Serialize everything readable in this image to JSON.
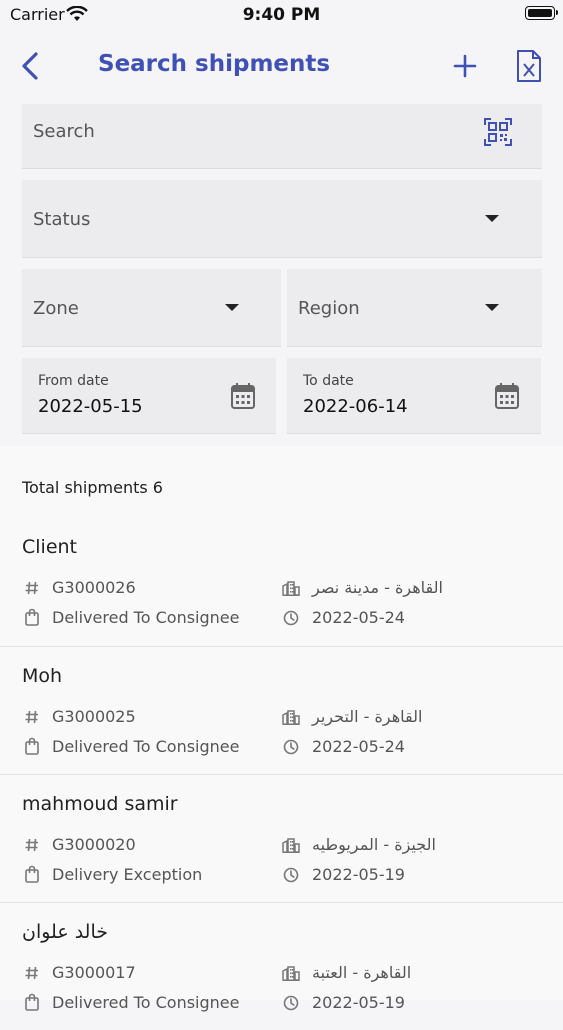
{
  "status_bar": {
    "carrier": "Carrier",
    "time": "9:40 PM"
  },
  "nav": {
    "title": "Search shipments"
  },
  "filters": {
    "search_placeholder": "Search",
    "status_label": "Status",
    "zone_label": "Zone",
    "region_label": "Region",
    "from_date_label": "From date",
    "from_date_value": "2022-05-15",
    "to_date_label": "To date",
    "to_date_value": "2022-06-14"
  },
  "summary": {
    "total_text": "Total shipments 6"
  },
  "shipments": [
    {
      "name": "Client",
      "code": "G3000026",
      "location": "القاهرة - مدينة نصر",
      "status": "Delivered To Consignee",
      "date": "2022-05-24"
    },
    {
      "name": "Moh",
      "code": "G3000025",
      "location": "القاهرة - التحرير",
      "status": "Delivered To Consignee",
      "date": "2022-05-24"
    },
    {
      "name": "mahmoud samir",
      "code": "G3000020",
      "location": "الجيزة - المريوطيه",
      "status": "Delivery Exception",
      "date": "2022-05-19"
    },
    {
      "name": "خالد علوان",
      "code": "G3000017",
      "location": "القاهرة - العتبة",
      "status": "Delivered To Consignee",
      "date": "2022-05-19"
    }
  ],
  "colors": {
    "accent": "#3f51b5",
    "field_bg": "#ececee",
    "page_bg": "#f5f5f7"
  }
}
